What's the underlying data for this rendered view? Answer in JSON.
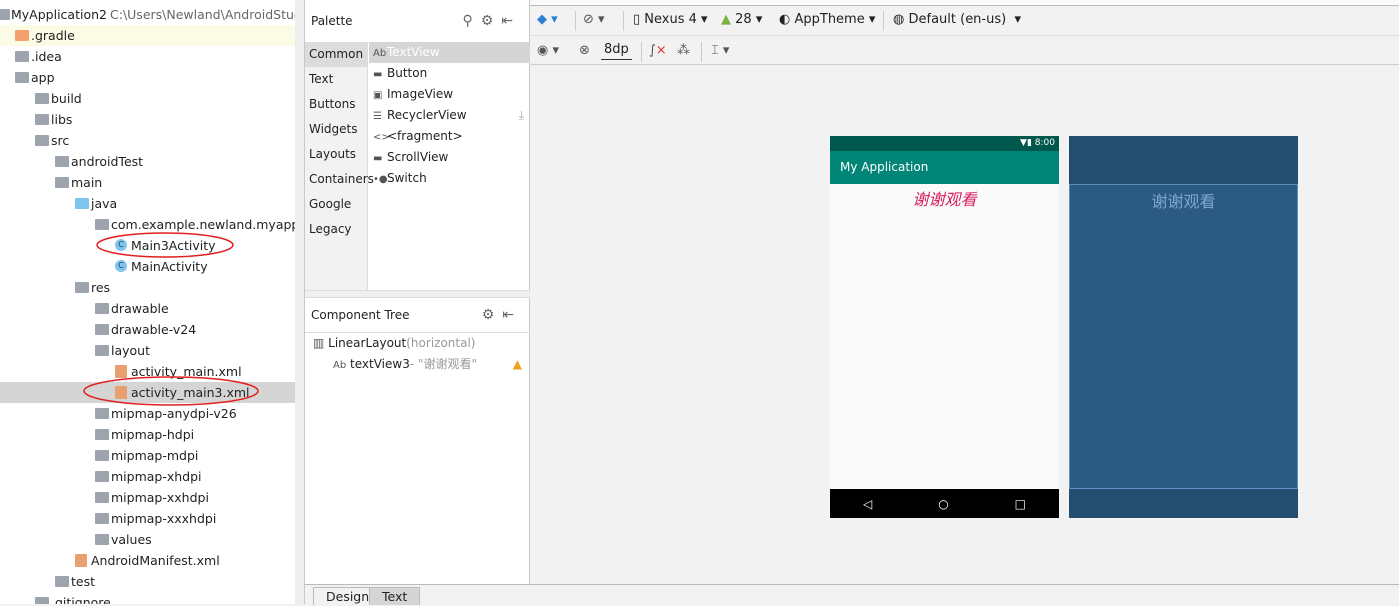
{
  "project": {
    "root": "MyApplication2",
    "root_path": "C:\\Users\\Newland\\AndroidStudio",
    "tree": [
      {
        "label": "MyApplication2",
        "level": 0,
        "icon": "module-icon",
        "expanded": true
      },
      {
        "label": ".gradle",
        "level": 1,
        "icon": "folder-orange-icon"
      },
      {
        "label": ".idea",
        "level": 1,
        "icon": "folder-icon"
      },
      {
        "label": "app",
        "level": 1,
        "icon": "module-folder-icon",
        "expanded": true
      },
      {
        "label": "build",
        "level": 2,
        "icon": "folder-icon",
        "expanded": false
      },
      {
        "label": "libs",
        "level": 2,
        "icon": "folder-icon"
      },
      {
        "label": "src",
        "level": 2,
        "icon": "folder-icon",
        "expanded": true
      },
      {
        "label": "androidTest",
        "level": 3,
        "icon": "folder-icon",
        "expanded": false
      },
      {
        "label": "main",
        "level": 3,
        "icon": "folder-icon",
        "expanded": true
      },
      {
        "label": "java",
        "level": 4,
        "icon": "folder-blue-icon",
        "expanded": true
      },
      {
        "label": "com.example.newland.myapplicati",
        "level": 5,
        "icon": "package-icon",
        "expanded": true
      },
      {
        "label": "Main3Activity",
        "level": 6,
        "icon": "class-icon"
      },
      {
        "label": "MainActivity",
        "level": 6,
        "icon": "class-icon"
      },
      {
        "label": "res",
        "level": 4,
        "icon": "folder-icon",
        "expanded": true
      },
      {
        "label": "drawable",
        "level": 5,
        "icon": "folder-icon",
        "expanded": false
      },
      {
        "label": "drawable-v24",
        "level": 5,
        "icon": "folder-icon",
        "expanded": false
      },
      {
        "label": "layout",
        "level": 5,
        "icon": "folder-icon",
        "expanded": true
      },
      {
        "label": "activity_main.xml",
        "level": 6,
        "icon": "xml-icon"
      },
      {
        "label": "activity_main3.xml",
        "level": 6,
        "icon": "xml-icon",
        "selected": true
      },
      {
        "label": "mipmap-anydpi-v26",
        "level": 5,
        "icon": "folder-icon",
        "expanded": false
      },
      {
        "label": "mipmap-hdpi",
        "level": 5,
        "icon": "folder-icon",
        "expanded": false
      },
      {
        "label": "mipmap-mdpi",
        "level": 5,
        "icon": "folder-icon",
        "expanded": false
      },
      {
        "label": "mipmap-xhdpi",
        "level": 5,
        "icon": "folder-icon",
        "expanded": false
      },
      {
        "label": "mipmap-xxhdpi",
        "level": 5,
        "icon": "folder-icon",
        "expanded": false
      },
      {
        "label": "mipmap-xxxhdpi",
        "level": 5,
        "icon": "folder-icon",
        "expanded": false
      },
      {
        "label": "values",
        "level": 5,
        "icon": "folder-icon",
        "expanded": false
      },
      {
        "label": "AndroidManifest.xml",
        "level": 4,
        "icon": "manifest-icon"
      },
      {
        "label": "test",
        "level": 3,
        "icon": "folder-icon",
        "expanded": false
      },
      {
        "label": ".gitignore",
        "level": 2,
        "icon": "file-icon"
      }
    ]
  },
  "palette": {
    "title": "Palette",
    "categories": [
      "Common",
      "Text",
      "Buttons",
      "Widgets",
      "Layouts",
      "Containers",
      "Google",
      "Legacy"
    ],
    "selected_category": "Common",
    "items": [
      {
        "g": "Ab",
        "label": "TextView"
      },
      {
        "g": "▬",
        "label": "Button"
      },
      {
        "g": "▣",
        "label": "ImageView"
      },
      {
        "g": "☰",
        "label": "RecyclerView"
      },
      {
        "g": "<>",
        "label": "<fragment>"
      },
      {
        "g": "▬",
        "label": "ScrollView"
      },
      {
        "g": "•●",
        "label": "Switch"
      }
    ]
  },
  "component_tree": {
    "title": "Component Tree",
    "root": "LinearLayout",
    "root_suffix": "(horizontal)",
    "child_prefix": "Ab",
    "child": "textView3",
    "child_suffix": "- \"谢谢观看\""
  },
  "toolbar": {
    "device": "Nexus 4",
    "api": "28",
    "theme": "AppTheme",
    "locale": "Default (en-us)",
    "margin": "8dp"
  },
  "preview": {
    "time": "8:00",
    "app_title": "My Application",
    "text": "谢谢观看",
    "text_color": "#d81b60",
    "appbar_color": "#008577",
    "status_color": "#00574b",
    "blueprint_color": "#234e70"
  },
  "tabs": [
    "Design",
    "Text"
  ],
  "annotation_color": "#e02020"
}
